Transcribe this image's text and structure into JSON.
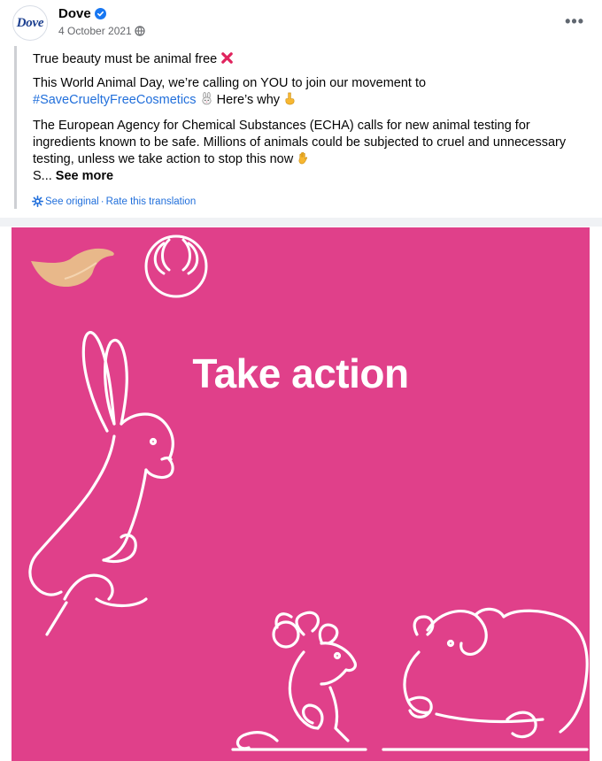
{
  "post": {
    "page_name": "Dove",
    "avatar_text": "Dove",
    "date": "4 October 2021",
    "more_label": "•••",
    "line1": "True beauty must be animal free",
    "line2_text": "This World Animal Day, we’re calling on YOU to join our movement to",
    "hashtag": "#SaveCrueltyFreeCosmetics",
    "line2_tail": "Here’s why",
    "line3": "The European Agency for Chemical Substances (ECHA) calls for new animal testing for ingredients known to be safe. Millions of animals could be subjected to cruel and unnecessary testing, unless we take action to stop this now",
    "truncated": "S...",
    "see_more": "See more",
    "see_original": "See original",
    "separator": "·",
    "rate_translation": "Rate this translation"
  },
  "image": {
    "headline": "Take action",
    "background": "#e0408a"
  },
  "colors": {
    "link": "#216fdb",
    "verified": "#1877f2",
    "muted": "#65676b"
  }
}
